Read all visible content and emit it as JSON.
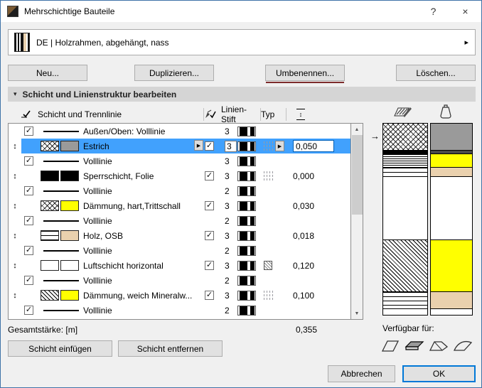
{
  "window": {
    "title": "Mehrschichtige Bauteile",
    "help_label": "?",
    "close_label": "×"
  },
  "selector": {
    "value": "DE | Holzrahmen, abgehängt, nass"
  },
  "actions": {
    "new": "Neu...",
    "duplicate": "Duplizieren...",
    "rename": "Umbenennen...",
    "delete": "Löschen..."
  },
  "section": {
    "title": "Schicht und Linienstruktur bearbeiten"
  },
  "table": {
    "header": {
      "layer_col": "Schicht und Trennlinie",
      "pen_col": "Linien-Stift",
      "type_col": "Typ"
    },
    "rows": [
      {
        "kind": "separator",
        "checked": true,
        "name": "Außen/Oben: Volllinie",
        "pen": "3"
      },
      {
        "kind": "layer",
        "selected": true,
        "name": "Estrich",
        "pen": "3",
        "pen_checked": true,
        "hatch": "crosshatch",
        "color": "#9a9a9a",
        "typ": "dashes-arrow",
        "thickness": "0,050"
      },
      {
        "kind": "separator",
        "checked": true,
        "name": "Volllinie",
        "pen": "3"
      },
      {
        "kind": "layer",
        "name": "Sperrschicht, Folie",
        "pen": "3",
        "pen_checked": true,
        "hatch": "solid",
        "color": "#000000",
        "typ": "dashes",
        "thickness": "0,000"
      },
      {
        "kind": "separator",
        "checked": true,
        "name": "Volllinie",
        "pen": "2"
      },
      {
        "kind": "layer",
        "name": "Dämmung, hart,Trittschall",
        "pen": "3",
        "pen_checked": true,
        "hatch": "crosshatch",
        "color": "#ffff00",
        "typ": "",
        "thickness": "0,030"
      },
      {
        "kind": "separator",
        "checked": true,
        "name": "Volllinie",
        "pen": "2"
      },
      {
        "kind": "layer",
        "name": "Holz, OSB",
        "pen": "3",
        "pen_checked": true,
        "hatch": "grain",
        "color": "#ead1ae",
        "typ": "",
        "thickness": "0,018"
      },
      {
        "kind": "separator",
        "checked": true,
        "name": "Volllinie",
        "pen": "2"
      },
      {
        "kind": "layer",
        "name": "Luftschicht horizontal",
        "pen": "3",
        "pen_checked": true,
        "hatch": "none",
        "color": "#ffffff",
        "typ": "hatchbox",
        "thickness": "0,120"
      },
      {
        "kind": "separator",
        "checked": true,
        "name": "Volllinie",
        "pen": "2"
      },
      {
        "kind": "layer",
        "name": "Dämmung, weich Mineralw...",
        "pen": "3",
        "pen_checked": true,
        "hatch": "diag",
        "color": "#ffff00",
        "typ": "dashes",
        "thickness": "0,100"
      },
      {
        "kind": "separator",
        "checked": true,
        "name": "Volllinie",
        "pen": "2"
      }
    ],
    "total_label": "Gesamtstärke: [m]",
    "total_value": "0,355"
  },
  "layer_actions": {
    "insert": "Schicht einfügen",
    "remove": "Schicht entfernen"
  },
  "preview": {
    "available_label": "Verfügbar für:",
    "segments": [
      {
        "hatch": "crosshatch",
        "color": "#9a9a9a",
        "pct": 14
      },
      {
        "hatch": "solid",
        "color": "#4a4a4a",
        "pct": 2
      },
      {
        "hatch": "hlines",
        "color": "#ffff00",
        "pct": 7
      },
      {
        "hatch": "grain",
        "color": "#ead1ae",
        "pct": 5
      },
      {
        "hatch": "none",
        "color": "#ffffff",
        "pct": 33
      },
      {
        "hatch": "diag",
        "color": "#ffff00",
        "pct": 27
      },
      {
        "hatch": "grain",
        "color": "#ead1ae",
        "pct": 9
      },
      {
        "hatch": "none",
        "color": "#ffffff",
        "pct": 3
      }
    ]
  },
  "dialog_actions": {
    "cancel": "Abbrechen",
    "ok": "OK"
  },
  "icons": {
    "section_triangle": "▾",
    "dropdown_arrow": "▸",
    "check": "✓",
    "updown": "↕",
    "popup_arrow": "▶",
    "scroll_up": "▲",
    "scroll_down": "▼",
    "selected_row_arrow": "→"
  },
  "colors": {
    "selection": "#41a1fd",
    "yellow": "#ffff00",
    "estrich_gray": "#9a9a9a",
    "wood": "#ead1ae"
  }
}
